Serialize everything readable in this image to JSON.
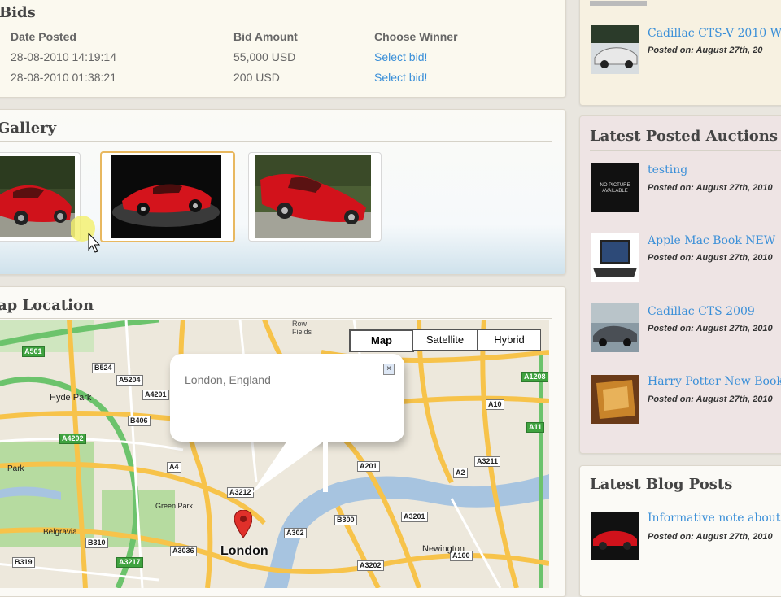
{
  "bids": {
    "title": "Bids",
    "headers": {
      "date": "Date Posted",
      "amount": "Bid Amount",
      "winner": "Choose Winner"
    },
    "rows": [
      {
        "date": "28-08-2010 14:19:14",
        "amount": "55,000 USD",
        "action": "Select bid!"
      },
      {
        "date": "28-08-2010 01:38:21",
        "amount": "200 USD",
        "action": "Select bid!"
      }
    ]
  },
  "gallery": {
    "title": "Gallery"
  },
  "map": {
    "title": "ap Location",
    "buttons": {
      "map": "Map",
      "satellite": "Satellite",
      "hybrid": "Hybrid"
    },
    "popup_text": "London, England",
    "city_label": "London",
    "places": {
      "hyde_park": "Hyde Park",
      "park": "Park",
      "belgravia": "Belgravia",
      "green_park": "Green Park",
      "newington": "Newington",
      "fields": "Fields",
      "row": "Row"
    },
    "roads": {
      "r1": "A501",
      "r2": "B524",
      "r3": "A5204",
      "r4": "A4201",
      "r5": "A4202",
      "r6": "B406",
      "r7": "A4",
      "r8": "A3212",
      "r9": "A302",
      "r10": "B310",
      "r11": "B319",
      "r12": "A3217",
      "r13": "A3202",
      "r14": "A3201",
      "r15": "B300",
      "r16": "A3211",
      "r17": "A2",
      "r18": "A10",
      "r19": "A1208",
      "r20": "A100",
      "r21": "A11",
      "r22": "A3036",
      "r23": "A201"
    }
  },
  "sidebar": {
    "top_item": {
      "title": "Cadillac CTS-V 2010 Wh",
      "meta": "Posted on: August 27th, 20"
    },
    "auctions": {
      "title": "Latest Posted Auctions",
      "items": [
        {
          "title": "testing",
          "meta": "Posted on: August 27th, 2010",
          "thumb_text": "NO PICTURE AVAILABLE"
        },
        {
          "title": "Apple Mac Book NEW",
          "meta": "Posted on: August 27th, 2010"
        },
        {
          "title": "Cadillac CTS 2009",
          "meta": "Posted on: August 27th, 2010"
        },
        {
          "title": "Harry Potter New Book",
          "meta": "Posted on: August 27th, 2010"
        }
      ]
    },
    "blog": {
      "title": "Latest Blog Posts",
      "items": [
        {
          "title": "Informative note about",
          "meta": "Posted on: August 27th, 2010"
        }
      ]
    }
  },
  "colors": {
    "link": "#3a8fd8",
    "heading": "#444444",
    "selected_border": "#e8b860",
    "map_road": "#f7c34a",
    "map_green": "#3fa23f"
  }
}
